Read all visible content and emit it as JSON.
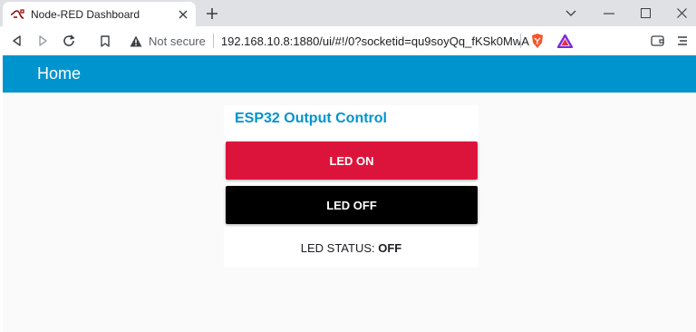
{
  "browser": {
    "tab": {
      "title": "Node-RED Dashboard"
    },
    "omnibox": {
      "security_label": "Not secure",
      "url": "192.168.10.8:1880/ui/#!/0?socketid=qu9soyQq_fKSk0MwA..."
    }
  },
  "dashboard": {
    "page_title": "Home",
    "group": {
      "title": "ESP32 Output Control",
      "buttons": [
        {
          "label": "LED ON",
          "color": "#dc143c"
        },
        {
          "label": "LED OFF",
          "color": "#000000"
        }
      ],
      "status": {
        "label": "LED STATUS:",
        "value": "OFF"
      }
    },
    "accent_color": "#0094ce"
  }
}
